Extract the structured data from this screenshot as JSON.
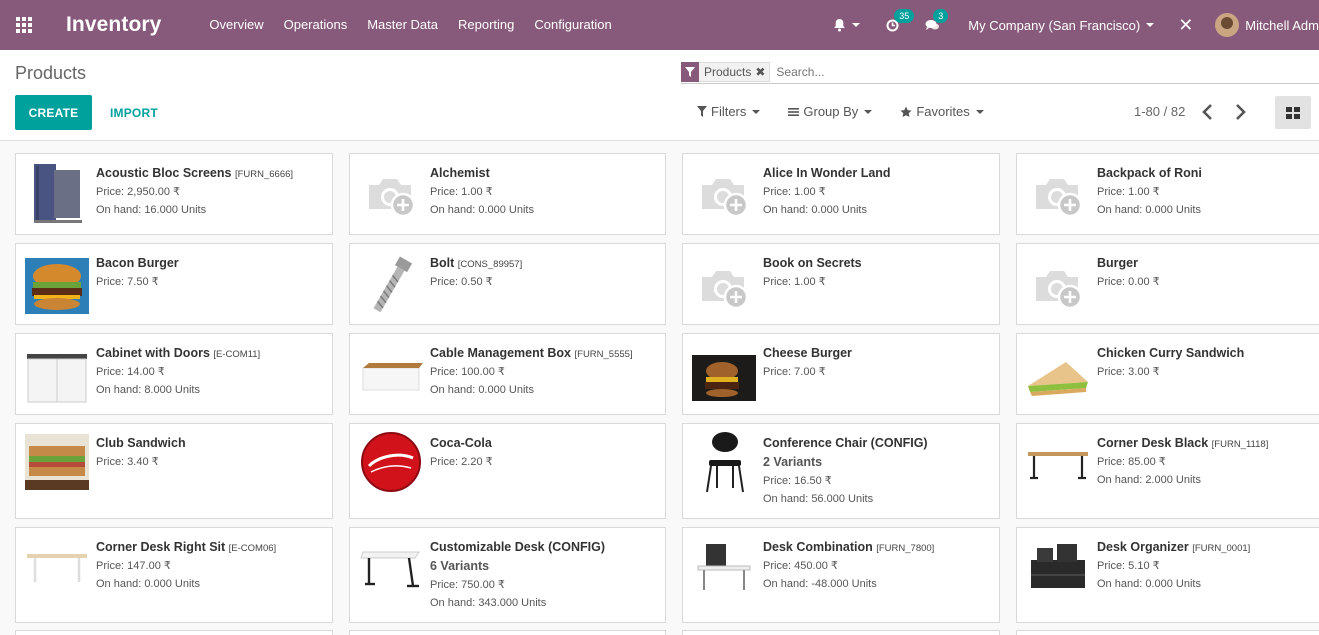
{
  "navbar": {
    "app_title": "Inventory",
    "menu": [
      "Overview",
      "Operations",
      "Master Data",
      "Reporting",
      "Configuration"
    ],
    "activity_count": "35",
    "messages_count": "3",
    "company": "My Company (San Francisco)",
    "user": "Mitchell Adm"
  },
  "control": {
    "breadcrumb": "Products",
    "facet_label": "Products",
    "search_placeholder": "Search...",
    "create_label": "CREATE",
    "import_label": "IMPORT",
    "filters_label": "Filters",
    "groupby_label": "Group By",
    "favorites_label": "Favorites",
    "pager": "1-80 / 82"
  },
  "products": [
    {
      "name": "Acoustic Bloc Screens",
      "ref": "[FURN_6666]",
      "price": "Price: 2,950.00 ₹",
      "onhand": "On hand: 16.000 Units",
      "image": "acoustic-screen"
    },
    {
      "name": "Alchemist",
      "ref": "",
      "price": "Price: 1.00 ₹",
      "onhand": "On hand: 0.000 Units",
      "image": "placeholder"
    },
    {
      "name": "Alice In Wonder Land",
      "ref": "",
      "price": "Price: 1.00 ₹",
      "onhand": "On hand: 0.000 Units",
      "image": "placeholder"
    },
    {
      "name": "Backpack of Roni",
      "ref": "",
      "price": "Price: 1.00 ₹",
      "onhand": "On hand: 0.000 Units",
      "image": "placeholder"
    },
    {
      "name": "Bacon Burger",
      "ref": "",
      "price": "Price: 7.50 ₹",
      "onhand": "",
      "image": "burger-photo"
    },
    {
      "name": "Bolt",
      "ref": "[CONS_89957]",
      "price": "Price: 0.50 ₹",
      "onhand": "",
      "image": "bolt"
    },
    {
      "name": "Book on Secrets",
      "ref": "",
      "price": "Price: 1.00 ₹",
      "onhand": "",
      "image": "placeholder"
    },
    {
      "name": "Burger",
      "ref": "",
      "price": "Price: 0.00 ₹",
      "onhand": "",
      "image": "placeholder"
    },
    {
      "name": "Cabinet with Doors",
      "ref": "[E-COM11]",
      "price": "Price: 14.00 ₹",
      "onhand": "On hand: 8.000 Units",
      "image": "cabinet"
    },
    {
      "name": "Cable Management Box",
      "ref": "[FURN_5555]",
      "price": "Price: 100.00 ₹",
      "onhand": "On hand: 0.000 Units",
      "image": "cable-box"
    },
    {
      "name": "Cheese Burger",
      "ref": "",
      "price": "Price: 7.00 ₹",
      "onhand": "",
      "image": "cheeseburger-photo"
    },
    {
      "name": "Chicken Curry Sandwich",
      "ref": "",
      "price": "Price: 3.00 ₹",
      "onhand": "",
      "image": "sandwich"
    },
    {
      "name": "Club Sandwich",
      "ref": "",
      "price": "Price: 3.40 ₹",
      "onhand": "",
      "image": "club-sandwich-photo"
    },
    {
      "name": "Coca-Cola",
      "ref": "",
      "price": "Price: 2.20 ₹",
      "onhand": "",
      "image": "coca-cola-logo"
    },
    {
      "name": "Conference Chair (CONFIG)",
      "ref": "",
      "variants": "2 Variants",
      "price": "Price: 16.50 ₹",
      "onhand": "On hand: 56.000 Units",
      "image": "chair"
    },
    {
      "name": "Corner Desk Black",
      "ref": "[FURN_1118]",
      "price": "Price: 85.00 ₹",
      "onhand": "On hand: 2.000 Units",
      "image": "desk-wood"
    },
    {
      "name": "Corner Desk Right Sit",
      "ref": "[E-COM06]",
      "price": "Price: 147.00 ₹",
      "onhand": "On hand: 0.000 Units",
      "image": "desk-light"
    },
    {
      "name": "Customizable Desk (CONFIG)",
      "ref": "",
      "variants": "6 Variants",
      "price": "Price: 750.00 ₹",
      "onhand": "On hand: 343.000 Units",
      "image": "desk-white"
    },
    {
      "name": "Desk Combination",
      "ref": "[FURN_7800]",
      "price": "Price: 450.00 ₹",
      "onhand": "On hand: -48.000 Units",
      "image": "desk-combination"
    },
    {
      "name": "Desk Organizer",
      "ref": "[FURN_0001]",
      "price": "Price: 5.10 ₹",
      "onhand": "On hand: 0.000 Units",
      "image": "desk-organizer"
    }
  ]
}
